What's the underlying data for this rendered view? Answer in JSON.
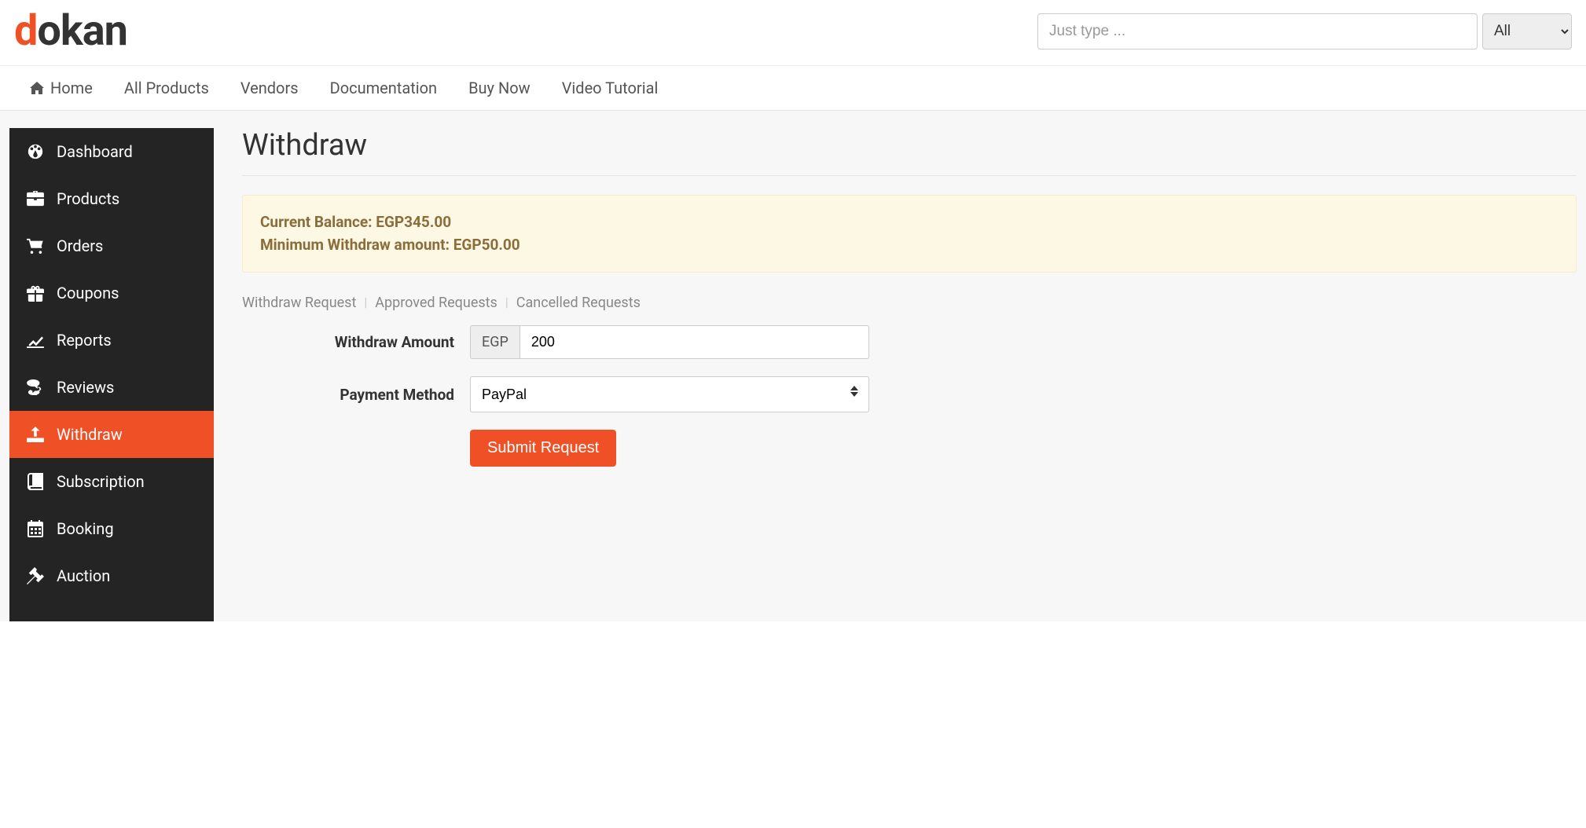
{
  "brand": {
    "prefix": "d",
    "rest": "okan"
  },
  "search": {
    "placeholder": "Just type ...",
    "filter": "All"
  },
  "topnav": {
    "home": "Home",
    "all_products": "All Products",
    "vendors": "Vendors",
    "documentation": "Documentation",
    "buy_now": "Buy Now",
    "video_tutorial": "Video Tutorial"
  },
  "sidebar": {
    "dashboard": "Dashboard",
    "products": "Products",
    "orders": "Orders",
    "coupons": "Coupons",
    "reports": "Reports",
    "reviews": "Reviews",
    "withdraw": "Withdraw",
    "subscription": "Subscription",
    "booking": "Booking",
    "auction": "Auction"
  },
  "page": {
    "title": "Withdraw",
    "balance_label": "Current Balance: ",
    "balance_value": "EGP345.00",
    "min_label": "Minimum Withdraw amount: ",
    "min_value": "EGP50.00"
  },
  "tabs": {
    "withdraw_request": "Withdraw Request",
    "approved": "Approved Requests",
    "cancelled": "Cancelled Requests"
  },
  "form": {
    "amount_label": "Withdraw Amount",
    "currency": "EGP",
    "amount_value": "200",
    "method_label": "Payment Method",
    "method_value": "PayPal",
    "submit": "Submit Request"
  }
}
